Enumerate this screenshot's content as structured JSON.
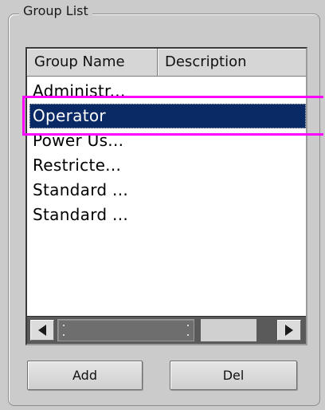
{
  "group_box": {
    "title": "Group List"
  },
  "list": {
    "columns": [
      "Group Name",
      "Description"
    ],
    "rows": [
      {
        "name": "Administr...",
        "selected": false
      },
      {
        "name": "Operator",
        "selected": true
      },
      {
        "name": "Power Us...",
        "selected": false
      },
      {
        "name": "Restricte...",
        "selected": false
      },
      {
        "name": "Standard ...",
        "selected": false
      },
      {
        "name": "Standard ...",
        "selected": false
      }
    ]
  },
  "buttons": {
    "add": "Add",
    "del": "Del"
  },
  "scrollbar": {
    "left_icon": "arrow-left-icon",
    "right_icon": "arrow-right-icon"
  },
  "colors": {
    "selection": "#0a2a66",
    "highlight": "#ff00ff"
  }
}
